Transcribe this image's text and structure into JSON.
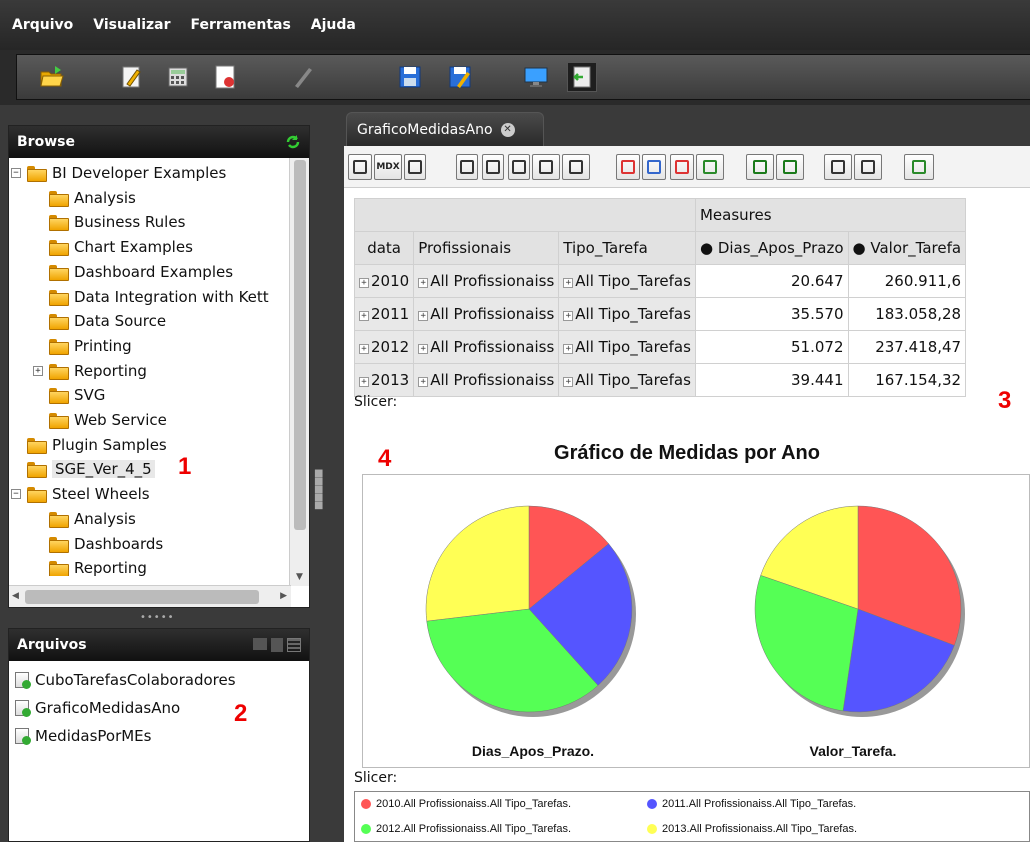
{
  "menu": [
    "Arquivo",
    "Visualizar",
    "Ferramentas",
    "Ajuda"
  ],
  "toolbar_icons": [
    "open-folder-icon",
    "edit-icon",
    "calculator-icon",
    "report-icon",
    "pencil-icon",
    "save-icon",
    "save-as-icon",
    "monitor-icon",
    "exit-icon"
  ],
  "browse": {
    "title": "Browse",
    "tree": [
      {
        "label": "BI Developer Examples",
        "level": 0,
        "expander": "−"
      },
      {
        "label": "Analysis",
        "level": 1,
        "expander": ""
      },
      {
        "label": "Business Rules",
        "level": 1,
        "expander": ""
      },
      {
        "label": "Chart Examples",
        "level": 1,
        "expander": ""
      },
      {
        "label": "Dashboard Examples",
        "level": 1,
        "expander": ""
      },
      {
        "label": "Data Integration with Kett",
        "level": 1,
        "expander": ""
      },
      {
        "label": "Data Source",
        "level": 1,
        "expander": ""
      },
      {
        "label": "Printing",
        "level": 1,
        "expander": ""
      },
      {
        "label": "Reporting",
        "level": 1,
        "expander": "+"
      },
      {
        "label": "SVG",
        "level": 1,
        "expander": ""
      },
      {
        "label": "Web Service",
        "level": 1,
        "expander": ""
      },
      {
        "label": "Plugin Samples",
        "level": 0,
        "expander": ""
      },
      {
        "label": "SGE_Ver_4_5",
        "level": 0,
        "expander": "",
        "selected": true
      },
      {
        "label": "Steel Wheels",
        "level": 0,
        "expander": "−"
      },
      {
        "label": "Analysis",
        "level": 1,
        "expander": ""
      },
      {
        "label": "Dashboards",
        "level": 1,
        "expander": ""
      },
      {
        "label": "Reporting",
        "level": 1,
        "expander": ""
      }
    ]
  },
  "files": {
    "title": "Arquivos",
    "items": [
      "CuboTarefasColaboradores",
      "GraficoMedidasAno",
      "MedidasPorMEs"
    ]
  },
  "annotations": [
    "1",
    "2",
    "3",
    "4"
  ],
  "tab": {
    "label": "GraficoMedidasAno"
  },
  "analysis_toolbar": [
    "cube-icon",
    "MDX",
    "sort-az-icon",
    "tree-icon",
    "column-icon",
    "table-icon",
    "drill-icon",
    "swap-icon",
    "collapse-icon",
    "expand-icon",
    "sort-icon",
    "export-icon",
    "bar-chart-icon",
    "chart-settings-icon",
    "print-icon",
    "pdf-icon",
    "excel-icon"
  ],
  "pivot": {
    "measures_header": "Measures",
    "headers": [
      "data",
      "Profissionais",
      "Tipo_Tarefa",
      "Dias_Apos_Prazo",
      "Valor_Tarefa"
    ],
    "rows": [
      [
        "2010",
        "All Profissionaiss",
        "All Tipo_Tarefas",
        "20.647",
        "260.911,6"
      ],
      [
        "2011",
        "All Profissionaiss",
        "All Tipo_Tarefas",
        "35.570",
        "183.058,28"
      ],
      [
        "2012",
        "All Profissionaiss",
        "All Tipo_Tarefas",
        "51.072",
        "237.418,47"
      ],
      [
        "2013",
        "All Profissionaiss",
        "All Tipo_Tarefas",
        "39.441",
        "167.154,32"
      ]
    ]
  },
  "slicer_label": "Slicer:",
  "chart_data": {
    "type": "pie",
    "title": "Gráfico de Medidas por Ano",
    "categories": [
      "2010",
      "2011",
      "2012",
      "2013"
    ],
    "colors": [
      "#ff5555",
      "#5555ff",
      "#55ff55",
      "#ffff55"
    ],
    "series": [
      {
        "name": "Dias_Apos_Prazo.",
        "values": [
          20647,
          35570,
          51072,
          39441
        ]
      },
      {
        "name": "Valor_Tarefa.",
        "values": [
          260911.6,
          183058.28,
          237418.47,
          167154.32
        ]
      }
    ],
    "legend": [
      "2010.All Profissionaiss.All Tipo_Tarefas.",
      "2011.All Profissionaiss.All Tipo_Tarefas.",
      "2012.All Profissionaiss.All Tipo_Tarefas.",
      "2013.All Profissionaiss.All Tipo_Tarefas."
    ],
    "legend_placement": "bottom"
  }
}
